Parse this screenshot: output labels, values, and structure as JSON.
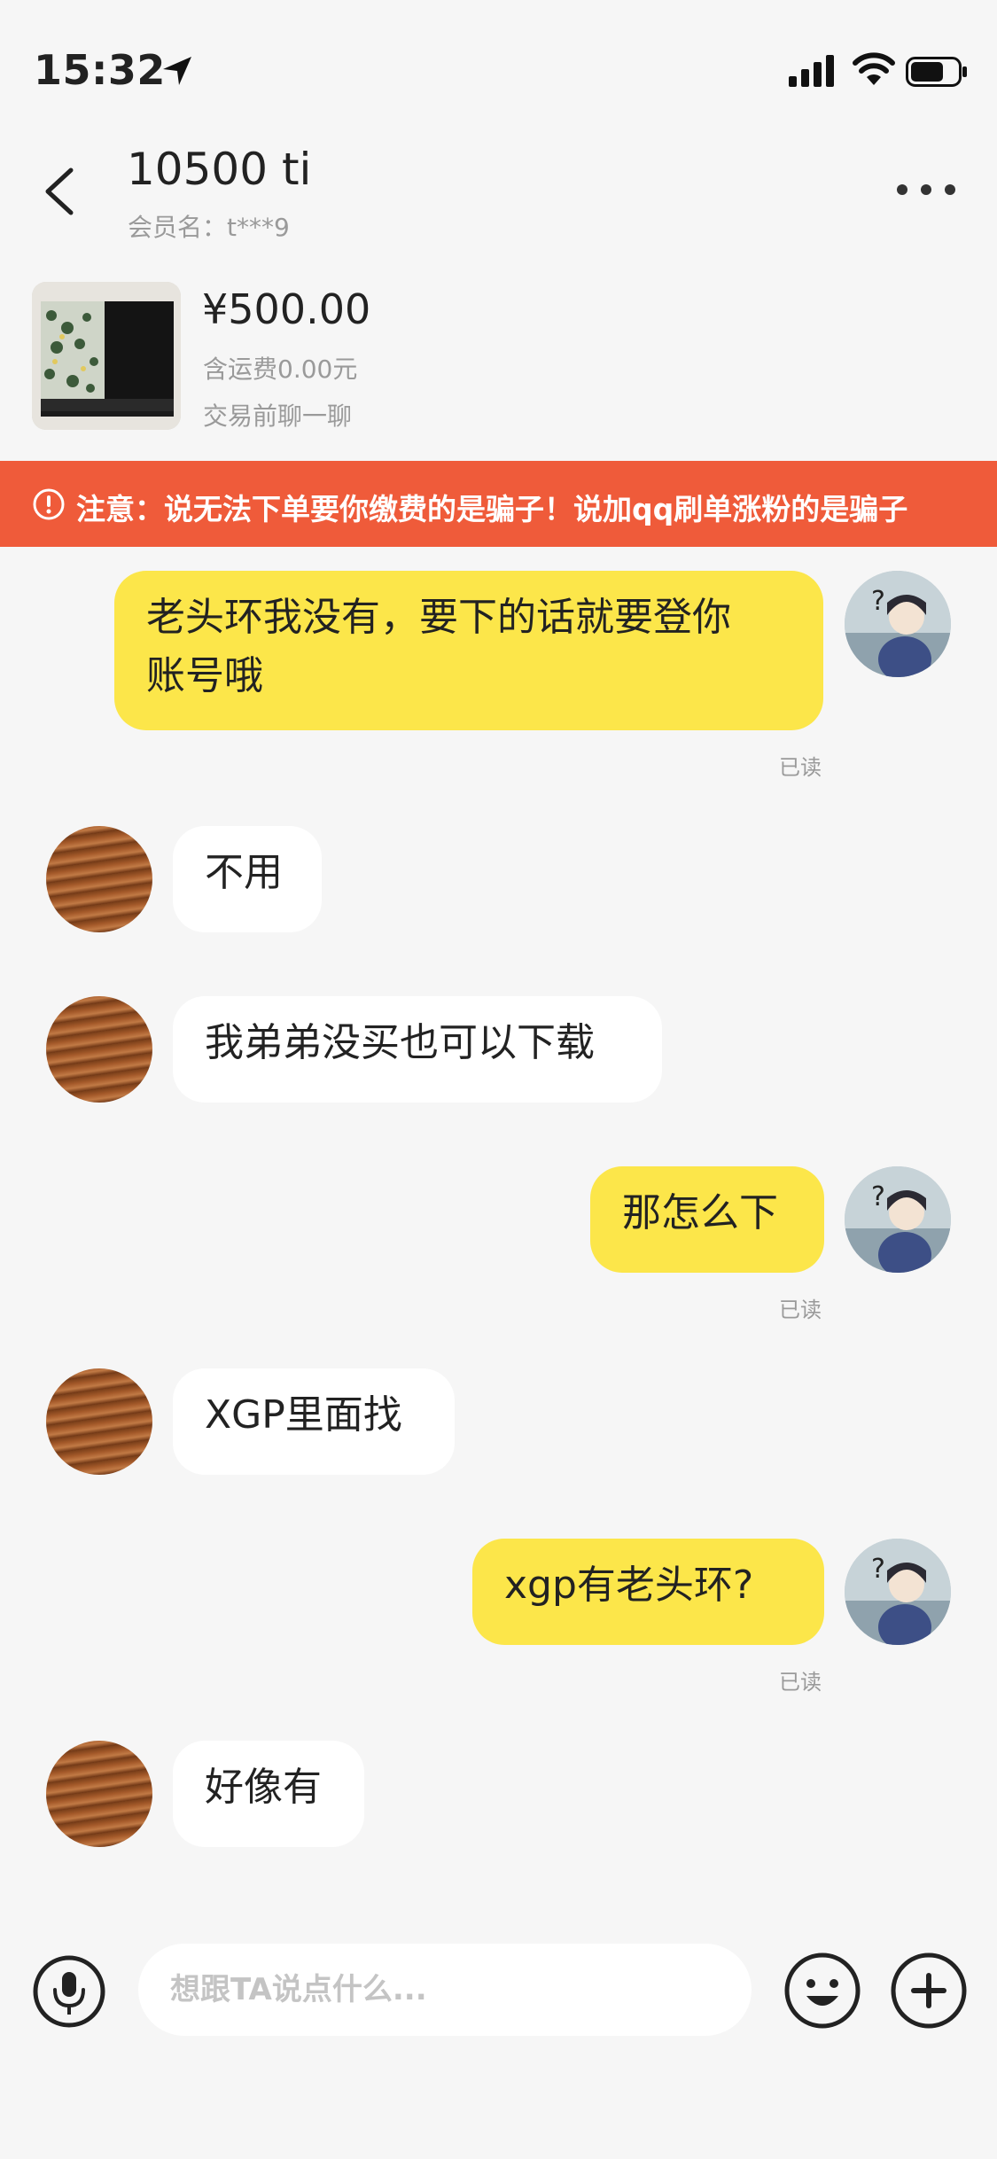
{
  "status": {
    "time": "15:32"
  },
  "header": {
    "title": "10500 ti",
    "member": "会员名：t***9"
  },
  "product": {
    "price": "¥500.00",
    "shipping": "含运费0.00元",
    "hint": "交易前聊一聊"
  },
  "banner": {
    "text": "注意：说无法下单要你缴费的是骗子！说加qq刷单涨粉的是骗子"
  },
  "messages": [
    {
      "side": "me",
      "line1": "老头环我没有，要下的话就要登你",
      "line2": "账号哦",
      "read": "已读"
    },
    {
      "side": "them",
      "text": "不用"
    },
    {
      "side": "them",
      "text": "我弟弟没买也可以下载"
    },
    {
      "side": "me",
      "text": "那怎么下",
      "read": "已读"
    },
    {
      "side": "them",
      "text": "XGP里面找"
    },
    {
      "side": "me",
      "text": "xgp有老头环?",
      "read": "已读"
    },
    {
      "side": "them",
      "text": "好像有"
    }
  ],
  "input": {
    "placeholder": "想跟TA说点什么..."
  },
  "colors": {
    "accent_bubble": "#fce64a",
    "banner": "#ef5b3a",
    "background": "#f6f6f6"
  }
}
